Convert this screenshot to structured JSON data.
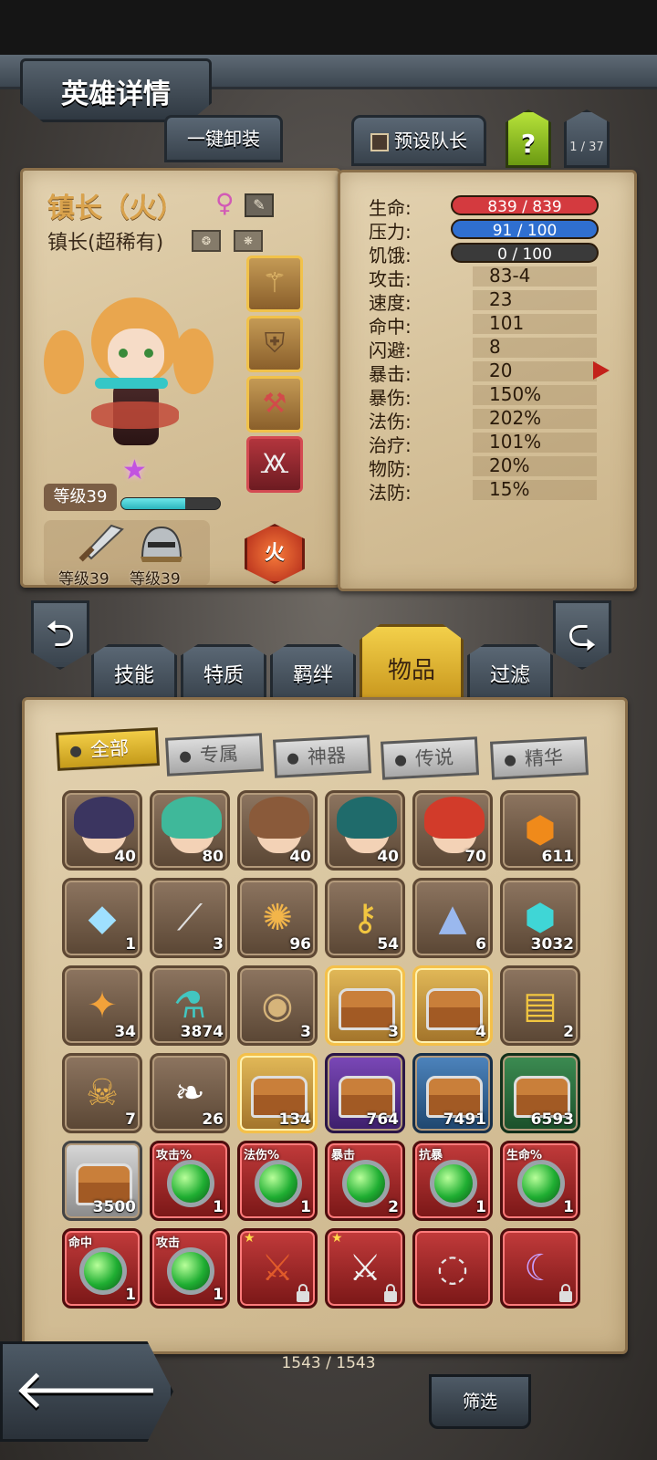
{
  "header": {
    "title": "英雄详情",
    "page_counter": "1 / 37",
    "help_label": "?"
  },
  "actions": {
    "unequip_all": "一键卸装",
    "preset_leader": "预设队长"
  },
  "hero": {
    "name": "镇长（火）",
    "class": "镇长(超稀有)",
    "level": "等级39",
    "xp_fraction": 0.65,
    "weapon_level": "等级39",
    "armor_level": "等级39",
    "element": "火"
  },
  "stats": {
    "bars": [
      {
        "label": "生命:",
        "value": "839 / 839",
        "color": "#d43a3f"
      },
      {
        "label": "压力:",
        "value": "91 / 100",
        "color": "#2f6fd0"
      },
      {
        "label": "饥饿:",
        "value": "0 / 100",
        "color": "#3a3a3a"
      }
    ],
    "rows": [
      {
        "label": "攻击:",
        "value": "83-4"
      },
      {
        "label": "速度:",
        "value": "23"
      },
      {
        "label": "命中:",
        "value": "101"
      },
      {
        "label": "闪避:",
        "value": "8"
      },
      {
        "label": "暴击:",
        "value": "20"
      },
      {
        "label": "暴伤:",
        "value": "150%"
      },
      {
        "label": "法伤:",
        "value": "202%"
      },
      {
        "label": "治疗:",
        "value": "101%"
      },
      {
        "label": "物防:",
        "value": "20%"
      },
      {
        "label": "法防:",
        "value": "15%"
      }
    ]
  },
  "tabs": [
    "技能",
    "特质",
    "羁绊",
    "物品",
    "过滤"
  ],
  "filters": [
    "全部",
    "专属",
    "神器",
    "传说",
    "精华"
  ],
  "inventory": {
    "items": [
      {
        "count": "40",
        "kind": "face",
        "hair": "#3b3560"
      },
      {
        "count": "80",
        "kind": "face",
        "hair": "#3fb89a"
      },
      {
        "count": "40",
        "kind": "face",
        "hair": "#8a5a3a"
      },
      {
        "count": "40",
        "kind": "face",
        "hair": "#1f6b6b"
      },
      {
        "count": "70",
        "kind": "face",
        "hair": "#d23b2a"
      },
      {
        "count": "611",
        "kind": "glyph",
        "glyph": "⬢",
        "color": "#f08a1a"
      },
      {
        "count": "1",
        "kind": "glyph",
        "glyph": "◆",
        "color": "#9fe0ff"
      },
      {
        "count": "3",
        "kind": "glyph",
        "glyph": "⟋",
        "color": "#e0e0e0"
      },
      {
        "count": "96",
        "kind": "glyph",
        "glyph": "✺",
        "color": "#f2b54a"
      },
      {
        "count": "54",
        "kind": "glyph",
        "glyph": "⚷",
        "color": "#f2c640"
      },
      {
        "count": "6",
        "kind": "glyph",
        "glyph": "▲",
        "color": "#9ab8ee"
      },
      {
        "count": "3032",
        "kind": "glyph",
        "glyph": "⬢",
        "color": "#3fd6d6"
      },
      {
        "count": "34",
        "kind": "glyph",
        "glyph": "✦",
        "color": "#f2a23a"
      },
      {
        "count": "3874",
        "kind": "glyph",
        "glyph": "⚗",
        "color": "#42c6c0"
      },
      {
        "count": "3",
        "kind": "glyph",
        "glyph": "◉",
        "color": "#d6b47a"
      },
      {
        "count": "3",
        "kind": "chest",
        "style": "gold"
      },
      {
        "count": "4",
        "kind": "chest",
        "style": "gold"
      },
      {
        "count": "2",
        "kind": "glyph",
        "glyph": "▤",
        "color": "#f2c640"
      },
      {
        "count": "7",
        "kind": "glyph",
        "glyph": "☠",
        "color": "#e8b04a"
      },
      {
        "count": "26",
        "kind": "glyph",
        "glyph": "❧",
        "color": "#ffffff"
      },
      {
        "count": "134",
        "kind": "chest",
        "style": "gold"
      },
      {
        "count": "764",
        "kind": "chest",
        "style": "purple"
      },
      {
        "count": "7491",
        "kind": "chest",
        "style": "blue"
      },
      {
        "count": "6593",
        "kind": "chest",
        "style": "green"
      },
      {
        "count": "3500",
        "kind": "chest",
        "style": "gray"
      },
      {
        "count": "1",
        "kind": "orb",
        "tag": "攻击%"
      },
      {
        "count": "1",
        "kind": "orb",
        "tag": "法伤%"
      },
      {
        "count": "2",
        "kind": "orb",
        "tag": "暴击"
      },
      {
        "count": "1",
        "kind": "orb",
        "tag": "抗暴"
      },
      {
        "count": "1",
        "kind": "orb",
        "tag": "生命%"
      },
      {
        "count": "1",
        "kind": "orb",
        "tag": "命中"
      },
      {
        "count": "1",
        "kind": "orb",
        "tag": "攻击"
      },
      {
        "count": "",
        "kind": "weapon",
        "glyph": "⚔",
        "color": "#e05a2a",
        "locked": true,
        "starred": true
      },
      {
        "count": "",
        "kind": "weapon",
        "glyph": "⚔",
        "color": "#f0f0f0",
        "locked": true,
        "starred": true
      },
      {
        "count": "",
        "kind": "weapon",
        "glyph": "◌",
        "color": "#e6e6e6",
        "locked": false,
        "starred": false
      },
      {
        "count": "",
        "kind": "weapon",
        "glyph": "☾",
        "color": "#c9a0ff",
        "locked": true,
        "starred": false
      }
    ],
    "total": "1543 / 1543"
  },
  "bottom": {
    "filter_label": "筛选",
    "back_label": "🡐"
  }
}
